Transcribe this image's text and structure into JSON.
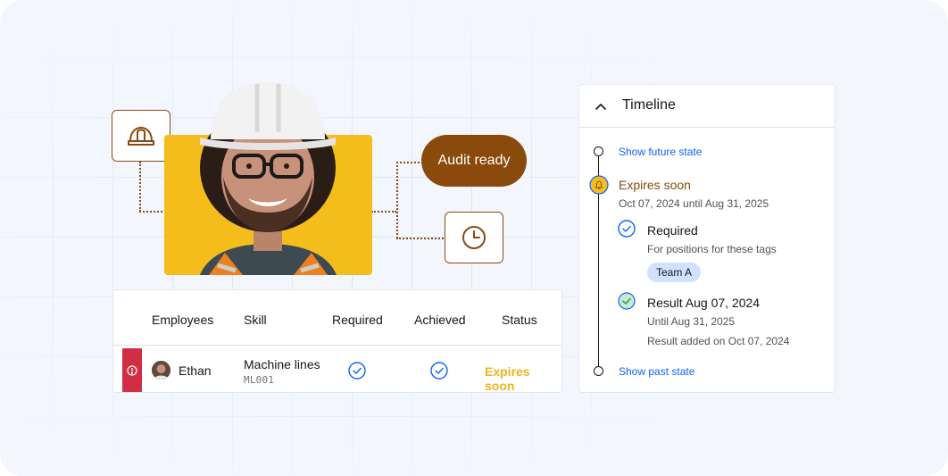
{
  "audit_pill": {
    "label": "Audit ready"
  },
  "icons": {
    "helmet": "helmet-icon",
    "clock": "clock-icon"
  },
  "table": {
    "headers": [
      "Employees",
      "Skill",
      "Required",
      "Achieved",
      "Status"
    ],
    "rows": [
      {
        "employee": "Ethan",
        "skill": "Machine lines",
        "skill_code": "ML001",
        "required": "check",
        "achieved": "check",
        "status": "Expires soon"
      }
    ]
  },
  "timeline": {
    "title": "Timeline",
    "show_future": "Show future state",
    "expires_title": "Expires soon",
    "expires_range": "Oct 07, 2024 until Aug 31, 2025",
    "required_title": "Required",
    "required_sub": "For positions for these tags",
    "tag": "Team A",
    "result_title": "Result Aug 07, 2024",
    "result_until": "Until Aug 31, 2025",
    "result_added": "Result added on Oct 07, 2024",
    "show_past": "Show past state"
  },
  "colors": {
    "brand_brown": "#8a4a0b",
    "photo_yellow": "#f5bd1c",
    "warning_yellow": "#f1b31c",
    "error_red": "#d12e46",
    "link_blue": "#0f62fe",
    "success_green": "#24a148"
  }
}
